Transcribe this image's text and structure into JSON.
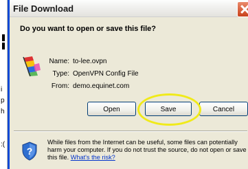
{
  "background": {
    "edge_chars": [
      "i",
      "p",
      "h",
      ":("
    ]
  },
  "dialog": {
    "title": "File Download",
    "question": "Do you want to open or save this file?",
    "file": {
      "name_label": "Name:",
      "name_value": "to-lee.ovpn",
      "type_label": "Type:",
      "type_value": "OpenVPN Config File",
      "from_label": "From:",
      "from_value": "demo.equinet.com"
    },
    "buttons": {
      "open": "Open",
      "save": "Save",
      "cancel": "Cancel"
    },
    "warning_text": "While files from the Internet can be useful, some files can potentially harm your computer. If you do not trust the source, do not open or save this file.",
    "risk_link": "What's the risk?",
    "highlight_color": "#f0ea1a",
    "title_accent": "#0a49d6"
  },
  "icons": {
    "file": "file-type-icon",
    "shield": "security-shield-icon",
    "close": "close-icon"
  }
}
